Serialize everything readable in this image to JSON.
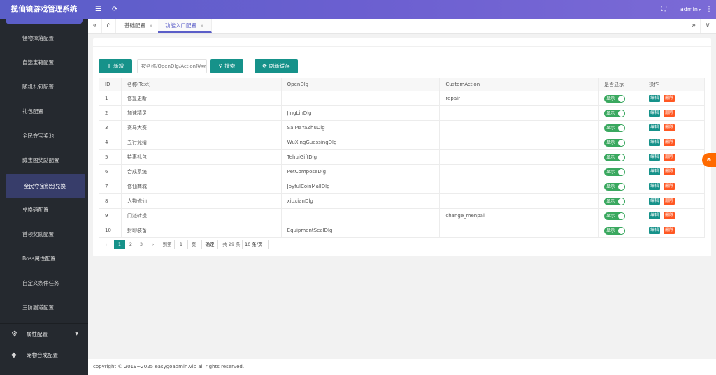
{
  "app": {
    "title": "揽仙镇游戏管理系统"
  },
  "topbar": {
    "user": "admin",
    "user_caret": "▾",
    "menu_icon": "☰",
    "refresh_icon": "⟳",
    "fullscreen_icon": "⛶",
    "more_icon": "⋮"
  },
  "sidebar": {
    "items": [
      {
        "label": "怪物掉落配置"
      },
      {
        "label": "自选宝箱配置"
      },
      {
        "label": "随机礼包配置"
      },
      {
        "label": "礼包配置"
      },
      {
        "label": "全民夺宝奖池"
      },
      {
        "label": "藏宝图奖励配置"
      },
      {
        "label": "全民夺宝积分兑换"
      },
      {
        "label": "兑换码配置"
      },
      {
        "label": "首领奖励配置"
      },
      {
        "label": "Boss属性配置"
      },
      {
        "label": "自定义条件任务"
      },
      {
        "label": "三阶副道配置"
      }
    ],
    "groups": [
      {
        "label": "属性配置",
        "icon": "⚙",
        "arrow": "▼"
      },
      {
        "label": "宠物合成配置",
        "icon": "◆"
      }
    ]
  },
  "tabbar": {
    "prev_icon": "«",
    "home_icon": "⌂",
    "next_icon": "»",
    "dropdown_icon": "∨",
    "tabs": [
      {
        "label": "基础配置",
        "close": "×"
      },
      {
        "label": "功能入口配置",
        "close": "×"
      }
    ]
  },
  "toolbar": {
    "add_label": "新增",
    "add_icon": "+",
    "search_placeholder": "按名称/OpenDlg/Action搜索",
    "search_label": "搜索",
    "search_icon": "⚲",
    "refresh_label": "刷新缓存",
    "refresh_icon": "⟳"
  },
  "table": {
    "headers": [
      "ID",
      "名称(Text)",
      "OpenDlg",
      "CustomAction",
      "是否显示",
      "操作"
    ],
    "toggle_label": "显示",
    "edit_label": "编辑",
    "delete_label": "删除",
    "rows": [
      {
        "id": "1",
        "text": "修复更新",
        "opendlg": "",
        "action": "repair"
      },
      {
        "id": "2",
        "text": "加速精灵",
        "opendlg": "JingLinDlg",
        "action": ""
      },
      {
        "id": "3",
        "text": "赛马大赛",
        "opendlg": "SaiMaYaZhuDlg",
        "action": ""
      },
      {
        "id": "4",
        "text": "五行竞猜",
        "opendlg": "WuXingGuessingDlg",
        "action": ""
      },
      {
        "id": "5",
        "text": "特惠礼包",
        "opendlg": "TehuiGiftDlg",
        "action": ""
      },
      {
        "id": "6",
        "text": "合成系统",
        "opendlg": "PetComposeDlg",
        "action": ""
      },
      {
        "id": "7",
        "text": "修仙商城",
        "opendlg": "JoyfulCoinMallDlg",
        "action": ""
      },
      {
        "id": "8",
        "text": "人物修仙",
        "opendlg": "xiuxianDlg",
        "action": ""
      },
      {
        "id": "9",
        "text": "门派转换",
        "opendlg": "",
        "action": "change_menpai"
      },
      {
        "id": "10",
        "text": "封印装备",
        "opendlg": "EquipmentSealDlg",
        "action": ""
      }
    ]
  },
  "pager": {
    "prev": "‹",
    "next": "›",
    "pages": [
      "1",
      "2",
      "3"
    ],
    "goto_label": "到第",
    "goto_value": "1",
    "page_unit": "页",
    "confirm": "确定",
    "total": "共 29 条",
    "size": "10 条/页"
  },
  "footer": {
    "copyright": "copyright © 2019~2025 easygoadmin.vip all rights reserved."
  },
  "float_badge": {
    "icon": "a"
  },
  "colors": {
    "primary": "#16928a",
    "danger": "#ff5722",
    "toggle_on": "#3aa85f",
    "sidebar_bg": "#25292f",
    "header_accent": "#5b5ec8"
  }
}
